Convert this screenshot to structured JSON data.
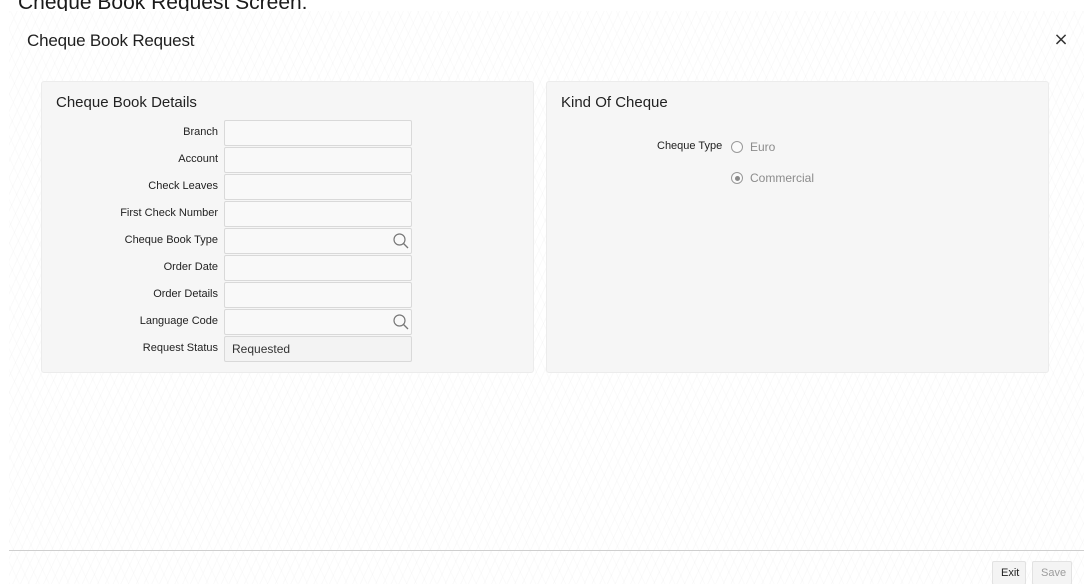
{
  "caption": "Cheque Book Request Screen:",
  "window": {
    "title": "Cheque Book Request",
    "close_label": "×"
  },
  "cheque_book_details": {
    "title": "Cheque Book Details",
    "fields": [
      {
        "label": "Branch",
        "value": ""
      },
      {
        "label": "Account",
        "value": ""
      },
      {
        "label": "Check Leaves",
        "value": ""
      },
      {
        "label": "First Check Number",
        "value": ""
      },
      {
        "label": "Cheque Book Type",
        "value": "",
        "has_search": true
      },
      {
        "label": "Order Date",
        "value": ""
      },
      {
        "label": "Order Details",
        "value": ""
      },
      {
        "label": "Language Code",
        "value": "",
        "has_search": true
      },
      {
        "label": "Request Status",
        "value": "Requested"
      }
    ]
  },
  "kind_of_cheque": {
    "title": "Kind Of Cheque",
    "cheque_type_label": "Cheque Type",
    "options": [
      {
        "label": "Euro",
        "checked": false
      },
      {
        "label": "Commercial",
        "checked": true
      }
    ]
  },
  "footer": {
    "exit_label": "Exit",
    "save_label": "Save"
  },
  "icons": {
    "search": "search-icon",
    "close": "close-icon"
  }
}
